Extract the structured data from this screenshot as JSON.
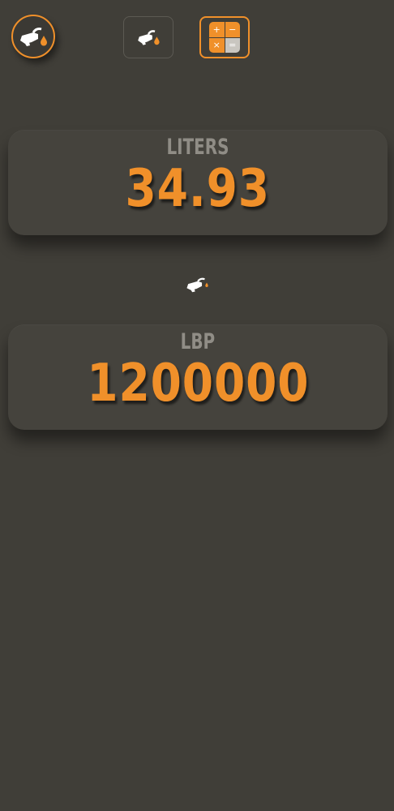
{
  "header": {
    "logo_icon": "fuel-pump-nozzle-drop-icon",
    "tabs": [
      {
        "name": "fuel-tab",
        "icon": "fuel-pump-nozzle-icon",
        "active": false
      },
      {
        "name": "calculator-tab",
        "icon": "calculator-icon",
        "active": true
      }
    ],
    "calculator_symbols": [
      "+",
      "−",
      "×",
      "="
    ]
  },
  "liters": {
    "label": "LITERS",
    "value": "34.93"
  },
  "divider_icon": "fuel-pump-nozzle-icon",
  "lbp": {
    "label": "LBP",
    "value": "1200000"
  },
  "colors": {
    "background": "#403e38",
    "accent": "#f0902a",
    "label_grey": "#908d86",
    "card": "#45433d"
  }
}
